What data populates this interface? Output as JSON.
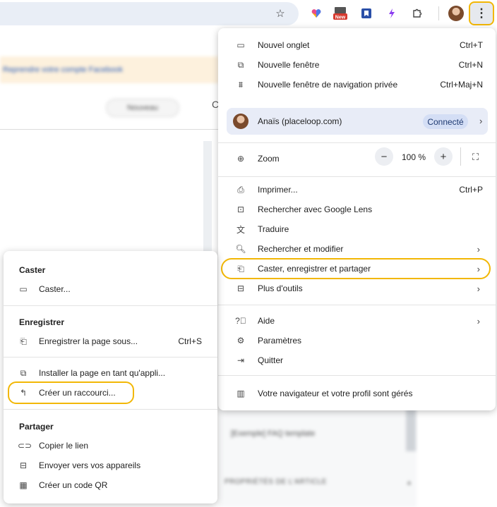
{
  "toolbar": {
    "icons": [
      "star-icon",
      "heart-extension-icon",
      "new-badge-extension-icon",
      "bookmark-extension-icon",
      "magic-extension-icon",
      "puzzle-icon",
      "profile-avatar",
      "kebab-menu-icon"
    ],
    "new_badge": "New"
  },
  "background": {
    "banner_text": "Reprendre votre compte Facebook",
    "nouveau_label": "Nouveau",
    "faq_text": "[Exemple] FAQ template",
    "properties_text": "PROPRIÉTÉS DE L'ARTICLE"
  },
  "main_menu": {
    "new_tab": {
      "label": "Nouvel onglet",
      "shortcut": "Ctrl+T"
    },
    "new_window": {
      "label": "Nouvelle fenêtre",
      "shortcut": "Ctrl+N"
    },
    "incognito": {
      "label": "Nouvelle fenêtre de navigation privée",
      "shortcut": "Ctrl+Maj+N"
    },
    "profile": {
      "name": "Anaïs (placeloop.com)",
      "status": "Connecté"
    },
    "zoom": {
      "label": "Zoom",
      "value": "100 %",
      "minus": "−",
      "plus": "+"
    },
    "print": {
      "label": "Imprimer...",
      "shortcut": "Ctrl+P"
    },
    "lens": {
      "label": "Rechercher avec Google Lens"
    },
    "translate": {
      "label": "Traduire"
    },
    "find": {
      "label": "Rechercher et modifier"
    },
    "cast_save_share": {
      "label": "Caster, enregistrer et partager"
    },
    "more_tools": {
      "label": "Plus d'outils"
    },
    "help": {
      "label": "Aide"
    },
    "settings": {
      "label": "Paramètres"
    },
    "quit": {
      "label": "Quitter"
    },
    "managed": {
      "label": "Votre navigateur et votre profil sont gérés"
    }
  },
  "sub_menu": {
    "cast_header": "Caster",
    "cast_item": "Caster...",
    "save_header": "Enregistrer",
    "save_page": {
      "label": "Enregistrer la page sous...",
      "shortcut": "Ctrl+S"
    },
    "install_app": "Installer la page en tant qu'appli...",
    "create_shortcut": "Créer un raccourci...",
    "share_header": "Partager",
    "copy_link": "Copier le lien",
    "send_devices": "Envoyer vers vos appareils",
    "qr_code": "Créer un code QR"
  },
  "colors": {
    "highlight": "#f2b705",
    "profile_bg": "#e8ecf7",
    "connected_bg": "#d4def5"
  }
}
